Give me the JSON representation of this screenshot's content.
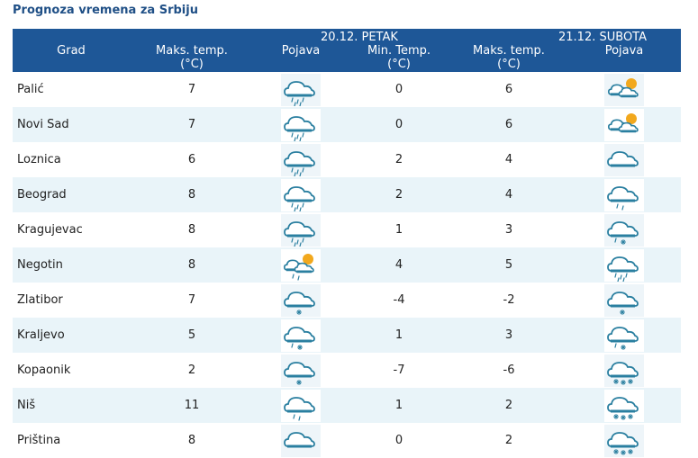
{
  "page_title": "Prognoza vremena za Srbiju",
  "header": {
    "city_col": "Grad",
    "day1_date": "20.12. PETAK",
    "day2_date": "21.12. SUBOTA",
    "max_temp": "Maks. temp.",
    "unit": "(°C)",
    "phenomenon": "Pojava",
    "min_temp": "Min. Temp."
  },
  "rows": [
    {
      "city": "Palić",
      "d1_max": "7",
      "d1_icon": "cloud-rain-icon",
      "d2_min": "0",
      "d2_max": "6",
      "d2_icon": "partly-cloudy-icon"
    },
    {
      "city": "Novi Sad",
      "d1_max": "7",
      "d1_icon": "cloud-rain-icon",
      "d2_min": "0",
      "d2_max": "6",
      "d2_icon": "partly-cloudy-icon"
    },
    {
      "city": "Loznica",
      "d1_max": "6",
      "d1_icon": "cloud-rain-icon",
      "d2_min": "2",
      "d2_max": "4",
      "d2_icon": "cloud-icon"
    },
    {
      "city": "Beograd",
      "d1_max": "8",
      "d1_icon": "cloud-rain-icon",
      "d2_min": "2",
      "d2_max": "4",
      "d2_icon": "cloud-light-rain-icon"
    },
    {
      "city": "Kragujevac",
      "d1_max": "8",
      "d1_icon": "cloud-rain-icon",
      "d2_min": "1",
      "d2_max": "3",
      "d2_icon": "cloud-rain-snow-icon"
    },
    {
      "city": "Negotin",
      "d1_max": "8",
      "d1_icon": "partly-cloudy-rain-icon",
      "d2_min": "4",
      "d2_max": "5",
      "d2_icon": "cloud-rain-icon"
    },
    {
      "city": "Zlatibor",
      "d1_max": "7",
      "d1_icon": "cloud-snow-icon",
      "d2_min": "-4",
      "d2_max": "-2",
      "d2_icon": "cloud-snow-icon"
    },
    {
      "city": "Kraljevo",
      "d1_max": "5",
      "d1_icon": "cloud-rain-snow-icon",
      "d2_min": "1",
      "d2_max": "3",
      "d2_icon": "cloud-rain-snow-icon"
    },
    {
      "city": "Kopaonik",
      "d1_max": "2",
      "d1_icon": "cloud-snow-icon",
      "d2_min": "-7",
      "d2_max": "-6",
      "d2_icon": "cloud-heavy-snow-icon"
    },
    {
      "city": "Niš",
      "d1_max": "11",
      "d1_icon": "cloud-light-rain-icon",
      "d2_min": "1",
      "d2_max": "2",
      "d2_icon": "cloud-heavy-snow-icon"
    },
    {
      "city": "Priština",
      "d1_max": "8",
      "d1_icon": "cloud-icon",
      "d2_min": "0",
      "d2_max": "2",
      "d2_icon": "cloud-heavy-snow-icon"
    }
  ],
  "colors": {
    "header_bg": "#1e5797",
    "title": "#1f4f86",
    "stripe": "#e9f4f9",
    "icon_cloud": "#2a7fa0",
    "icon_sun": "#f2a81d"
  }
}
